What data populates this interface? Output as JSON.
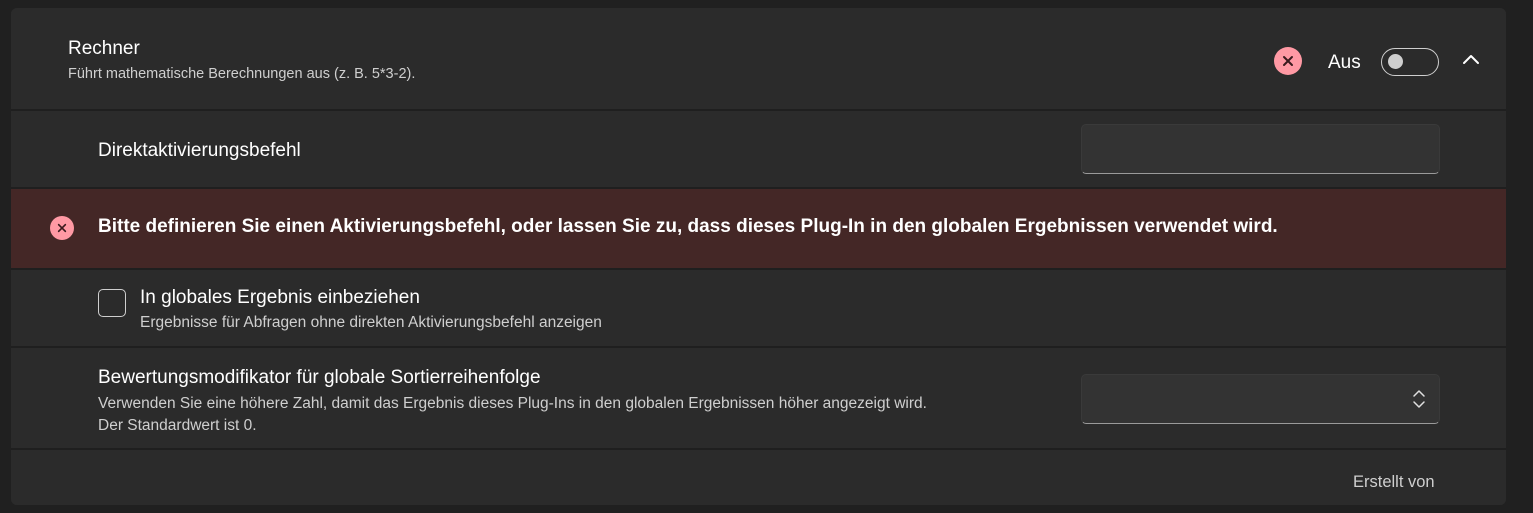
{
  "plugin": {
    "title": "Rechner",
    "description": "Führt mathematische Berechnungen aus (z. B. 5*3-2).",
    "toggle_label": "Aus",
    "enabled": false
  },
  "direct_activation": {
    "label": "Direktaktivierungsbefehl",
    "value": ""
  },
  "error": {
    "message": "Bitte definieren Sie einen Aktivierungsbefehl, oder lassen Sie zu, dass dieses Plug-In in den globalen Ergebnissen verwendet wird."
  },
  "global_results": {
    "label": "In globales Ergebnis einbeziehen",
    "description": "Ergebnisse für Abfragen ohne direkten Aktivierungsbefehl anzeigen",
    "checked": false
  },
  "weight_modifier": {
    "label": "Bewertungsmodifikator für globale Sortierreihenfolge",
    "description_line1": "Verwenden Sie eine höhere Zahl, damit das Ergebnis dieses Plug-Ins in den globalen Ergebnissen höher angezeigt wird.",
    "description_line2": "Der Standardwert ist 0.",
    "value": ""
  },
  "footer": {
    "created_by_label": "Erstellt von"
  },
  "colors": {
    "error_accent": "#ff99a4",
    "error_background": "#442726",
    "card_background": "#2b2b2b"
  },
  "icons": {
    "error": "close-circle-icon",
    "collapse": "chevron-up-icon",
    "spin": "up-down-chevron-icon"
  }
}
